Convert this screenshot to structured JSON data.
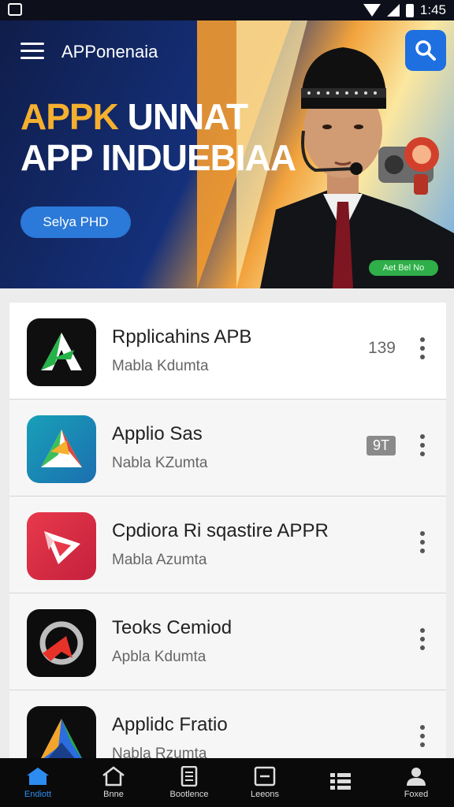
{
  "status_bar": {
    "time": "1:45"
  },
  "header": {
    "title": "APPonenaia"
  },
  "hero": {
    "headline_line1_accent": "APPK",
    "headline_line1_rest": " UNNAT",
    "headline_line2": "APP INDUEBIAA",
    "button_label": "Selya PHD",
    "badge": "Aet Bel No"
  },
  "apps": [
    {
      "name": "Rpplicahins APB",
      "subtitle": "Mabla Kdumta",
      "count": "139",
      "icon": "green-a-icon"
    },
    {
      "name": "Applio Sas",
      "subtitle": "Nabla KZumta",
      "count": "9T",
      "icon": "colorful-a-icon"
    },
    {
      "name": "Cpdiora Ri sqastire APPR",
      "subtitle": "Mabla Azumta",
      "count": "",
      "icon": "red-arrow-icon"
    },
    {
      "name": "Teoks Cemiod",
      "subtitle": "Apbla Kdumta",
      "count": "",
      "icon": "red-ring-icon"
    },
    {
      "name": "Applidc Fratio",
      "subtitle": "Nabla Rzumta",
      "count": "",
      "icon": "prism-a-icon"
    }
  ],
  "bottom_nav": [
    {
      "label": "Endiott",
      "icon": "home-filled-icon",
      "active": true
    },
    {
      "label": "Bnne",
      "icon": "home-outline-icon",
      "active": false
    },
    {
      "label": "Bootlence",
      "icon": "document-icon",
      "active": false
    },
    {
      "label": "Leeons",
      "icon": "message-icon",
      "active": false
    },
    {
      "label": "",
      "icon": "grid-icon",
      "active": false
    },
    {
      "label": "Foxed",
      "icon": "profile-icon",
      "active": false
    }
  ]
}
